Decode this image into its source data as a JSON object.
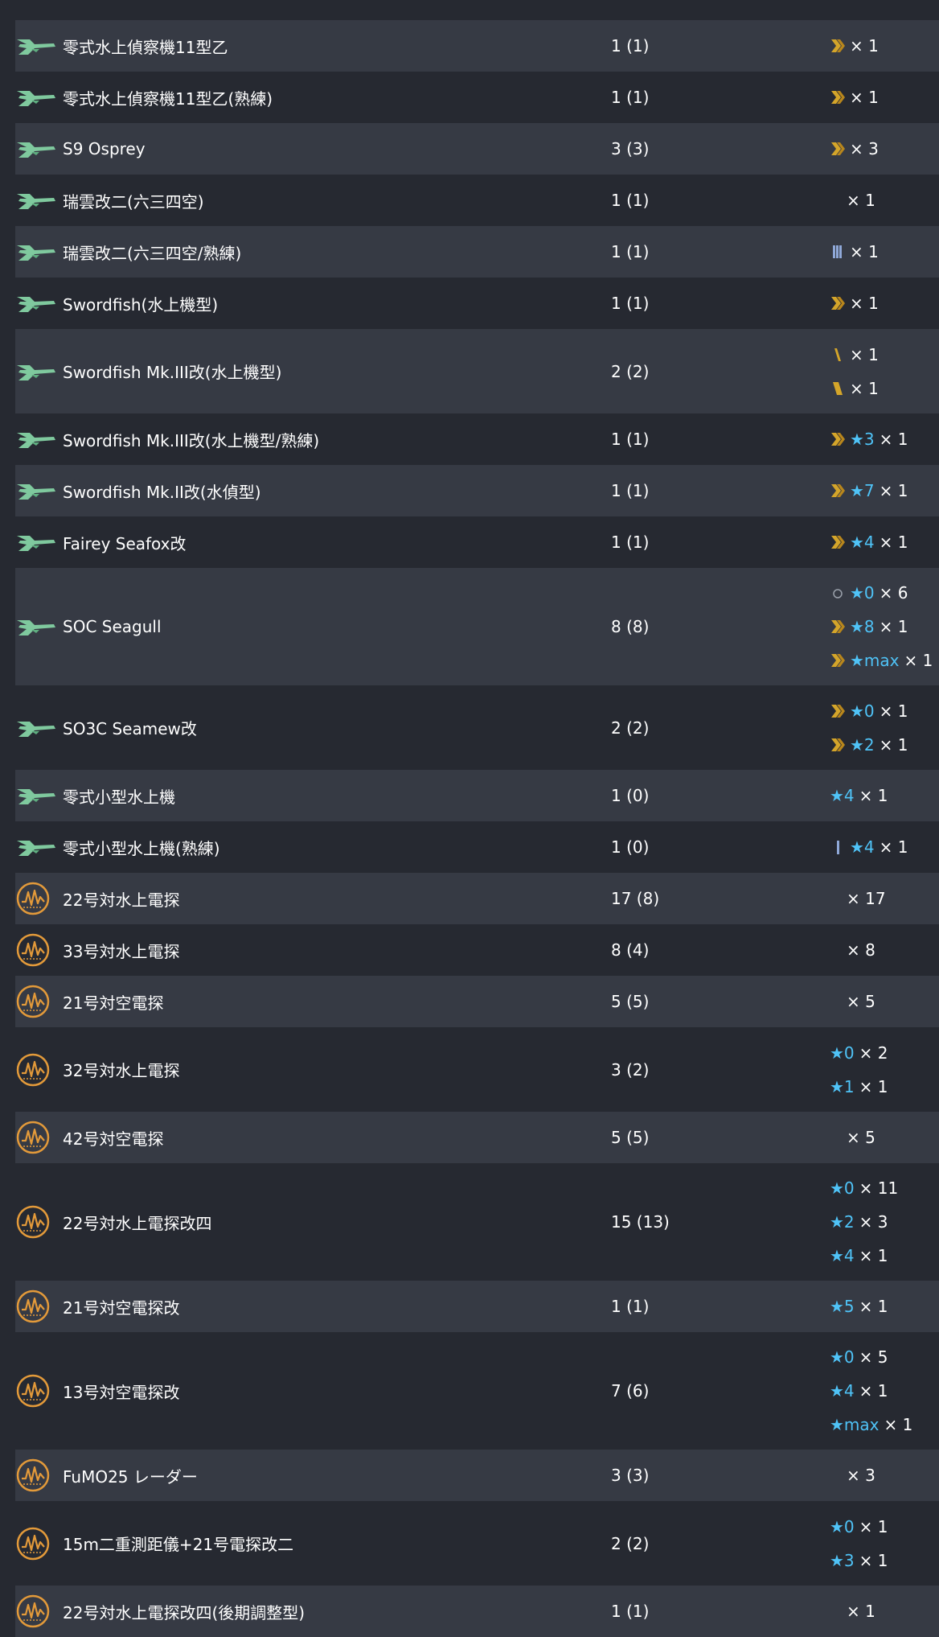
{
  "colors": {
    "background": "#262931",
    "row_alt": "#363a44",
    "star": "#4fc3f7",
    "chevron": "#d4a52a",
    "seaplane_icon": "#7fc99e",
    "radar_icon": "#e39a3a"
  },
  "rows": [
    {
      "icon": "seaplane-icon",
      "name": "零式水上偵察機11型乙",
      "count": "1 (1)",
      "levels": [
        {
          "mark": "chevron-double",
          "star": "",
          "qty": "× 1"
        }
      ]
    },
    {
      "icon": "seaplane-icon",
      "name": "零式水上偵察機11型乙(熟練)",
      "count": "1 (1)",
      "levels": [
        {
          "mark": "chevron-double",
          "star": "",
          "qty": "× 1"
        }
      ]
    },
    {
      "icon": "seaplane-icon",
      "name": "S9 Osprey",
      "count": "3 (3)",
      "levels": [
        {
          "mark": "chevron-double",
          "star": "",
          "qty": "× 3"
        }
      ]
    },
    {
      "icon": "seaplane-icon",
      "name": "瑞雲改二(六三四空)",
      "count": "1 (1)",
      "levels": [
        {
          "mark": "",
          "star": "",
          "qty": "× 1"
        }
      ]
    },
    {
      "icon": "seaplane-icon",
      "name": "瑞雲改二(六三四空/熟練)",
      "count": "1 (1)",
      "levels": [
        {
          "mark": "bars-blue",
          "star": "",
          "qty": "× 1"
        }
      ]
    },
    {
      "icon": "seaplane-icon",
      "name": "Swordfish(水上機型)",
      "count": "1 (1)",
      "levels": [
        {
          "mark": "chevron-double",
          "star": "",
          "qty": "× 1"
        }
      ]
    },
    {
      "icon": "seaplane-icon",
      "name": "Swordfish Mk.III改(水上機型)",
      "count": "2 (2)",
      "levels": [
        {
          "mark": "slash-single",
          "star": "",
          "qty": "× 1"
        },
        {
          "mark": "slash-double",
          "star": "",
          "qty": "× 1"
        }
      ]
    },
    {
      "icon": "seaplane-icon",
      "name": "Swordfish Mk.III改(水上機型/熟練)",
      "count": "1 (1)",
      "levels": [
        {
          "mark": "chevron-double",
          "star": "★3",
          "qty": "× 1"
        }
      ]
    },
    {
      "icon": "seaplane-icon",
      "name": "Swordfish Mk.II改(水偵型)",
      "count": "1 (1)",
      "levels": [
        {
          "mark": "chevron-double",
          "star": "★7",
          "qty": "× 1"
        }
      ]
    },
    {
      "icon": "seaplane-icon",
      "name": "Fairey Seafox改",
      "count": "1 (1)",
      "levels": [
        {
          "mark": "chevron-double",
          "star": "★4",
          "qty": "× 1"
        }
      ]
    },
    {
      "icon": "seaplane-icon",
      "name": "SOC Seagull",
      "count": "8 (8)",
      "levels": [
        {
          "mark": "circle-gray",
          "star": "★0",
          "qty": "× 6"
        },
        {
          "mark": "chevron-double",
          "star": "★8",
          "qty": "× 1"
        },
        {
          "mark": "chevron-double",
          "star": "★max",
          "qty": "× 1"
        }
      ]
    },
    {
      "icon": "seaplane-icon",
      "name": "SO3C Seamew改",
      "count": "2 (2)",
      "levels": [
        {
          "mark": "chevron-double",
          "star": "★0",
          "qty": "× 1"
        },
        {
          "mark": "chevron-double",
          "star": "★2",
          "qty": "× 1"
        }
      ]
    },
    {
      "icon": "seaplane-icon",
      "name": "零式小型水上機",
      "count": "1 (0)",
      "levels": [
        {
          "mark": "none",
          "star": "★4",
          "qty": "× 1"
        }
      ]
    },
    {
      "icon": "seaplane-icon",
      "name": "零式小型水上機(熟練)",
      "count": "1 (0)",
      "levels": [
        {
          "mark": "bar-blue",
          "star": "★4",
          "qty": "× 1"
        }
      ]
    },
    {
      "icon": "radar-icon",
      "name": "22号対水上電探",
      "count": "17 (8)",
      "levels": [
        {
          "mark": "",
          "star": "",
          "qty": "× 17"
        }
      ]
    },
    {
      "icon": "radar-icon",
      "name": "33号対水上電探",
      "count": "8 (4)",
      "levels": [
        {
          "mark": "",
          "star": "",
          "qty": "× 8"
        }
      ]
    },
    {
      "icon": "radar-icon",
      "name": "21号対空電探",
      "count": "5 (5)",
      "levels": [
        {
          "mark": "",
          "star": "",
          "qty": "× 5"
        }
      ]
    },
    {
      "icon": "radar-icon",
      "name": "32号対水上電探",
      "count": "3 (2)",
      "levels": [
        {
          "mark": "none",
          "star": "★0",
          "qty": "× 2"
        },
        {
          "mark": "none",
          "star": "★1",
          "qty": "× 1"
        }
      ]
    },
    {
      "icon": "radar-icon",
      "name": "42号対空電探",
      "count": "5 (5)",
      "levels": [
        {
          "mark": "",
          "star": "",
          "qty": "× 5"
        }
      ]
    },
    {
      "icon": "radar-icon",
      "name": "22号対水上電探改四",
      "count": "15 (13)",
      "levels": [
        {
          "mark": "none",
          "star": "★0",
          "qty": "× 11"
        },
        {
          "mark": "none",
          "star": "★2",
          "qty": "× 3"
        },
        {
          "mark": "none",
          "star": "★4",
          "qty": "× 1"
        }
      ]
    },
    {
      "icon": "radar-icon",
      "name": "21号対空電探改",
      "count": "1 (1)",
      "levels": [
        {
          "mark": "none",
          "star": "★5",
          "qty": "× 1"
        }
      ]
    },
    {
      "icon": "radar-icon",
      "name": "13号対空電探改",
      "count": "7 (6)",
      "levels": [
        {
          "mark": "none",
          "star": "★0",
          "qty": "× 5"
        },
        {
          "mark": "none",
          "star": "★4",
          "qty": "× 1"
        },
        {
          "mark": "none",
          "star": "★max",
          "qty": "× 1"
        }
      ]
    },
    {
      "icon": "radar-icon",
      "name": "FuMO25 レーダー",
      "count": "3 (3)",
      "levels": [
        {
          "mark": "",
          "star": "",
          "qty": "× 3"
        }
      ]
    },
    {
      "icon": "radar-icon",
      "name": "15m二重測距儀+21号電探改二",
      "count": "2 (2)",
      "levels": [
        {
          "mark": "none",
          "star": "★0",
          "qty": "× 1"
        },
        {
          "mark": "none",
          "star": "★3",
          "qty": "× 1"
        }
      ]
    },
    {
      "icon": "radar-icon",
      "name": "22号対水上電探改四(後期調整型)",
      "count": "1 (1)",
      "levels": [
        {
          "mark": "",
          "star": "",
          "qty": "× 1"
        }
      ]
    }
  ]
}
